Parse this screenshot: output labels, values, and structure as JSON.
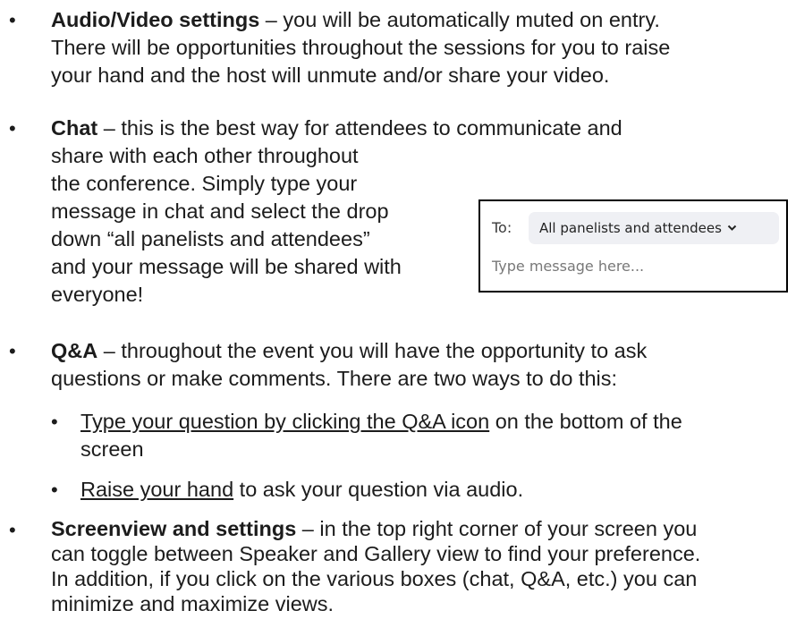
{
  "bullet_glyph": "•",
  "items": {
    "audio": {
      "title": "Audio/Video settings",
      "lines": [
        " – you will be automatically muted on entry.",
        "There will be opportunities throughout the sessions for you to raise",
        "your hand and the host will unmute and/or share your video."
      ]
    },
    "chat": {
      "title": "Chat",
      "lines": [
        " – this is the best way for attendees to communicate and",
        "share with each other throughout",
        "the conference. Simply type your",
        "message in chat and select the drop",
        "down “all panelists and attendees”",
        "and your message will be shared with",
        "everyone!"
      ]
    },
    "qa": {
      "title": "Q&A",
      "lines": [
        " – throughout the event you will have the opportunity to ask",
        "questions or make comments. There are two ways to do this:"
      ],
      "sub1": {
        "underlined": "Type your question by clicking the Q&A icon",
        "rest": " on the bottom of the",
        "line2": "screen"
      },
      "sub2": {
        "underlined": "Raise your hand",
        "rest": " to ask your question via audio."
      }
    },
    "screenview": {
      "title": "Screenview and settings",
      "lines": [
        " – in the top right corner of your screen you",
        "can toggle between Speaker and Gallery view to find your preference.",
        "In addition, if you click on the various boxes (chat, Q&A, etc.) you can",
        "minimize and maximize views."
      ]
    }
  },
  "chat_panel": {
    "to_label": "To:",
    "recipient": "All panelists and attendees",
    "input_placeholder": "Type message here...",
    "icon": "chevron-down-icon"
  }
}
